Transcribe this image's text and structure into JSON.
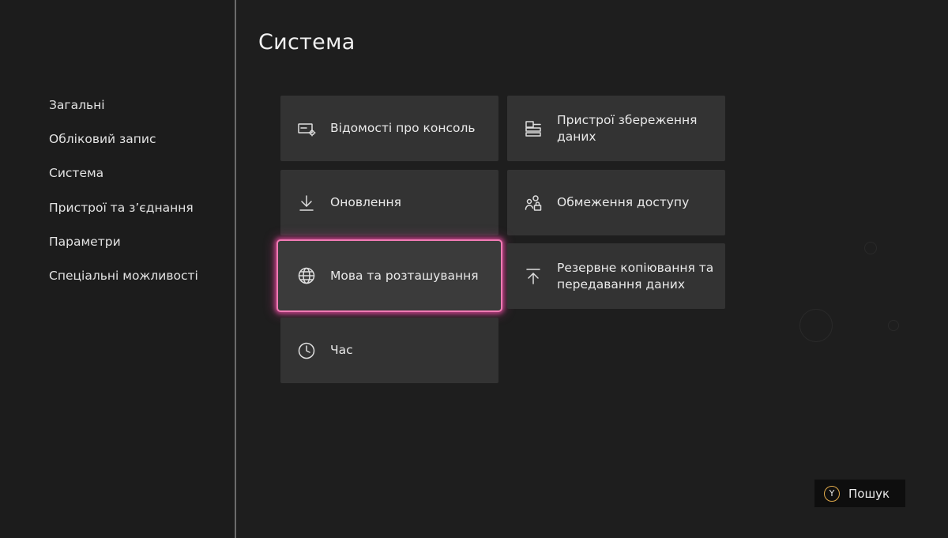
{
  "sidebar": {
    "items": [
      {
        "label": "Загальні"
      },
      {
        "label": "Обліковий запис"
      },
      {
        "label": "Система"
      },
      {
        "label": "Пристрої та з’єднання"
      },
      {
        "label": "Параметри"
      },
      {
        "label": "Спеціальні можливості"
      }
    ]
  },
  "page": {
    "title": "Система"
  },
  "tiles": [
    {
      "label": "Відомості про консоль",
      "icon": "console-info-icon"
    },
    {
      "label": "Пристрої збереження даних",
      "icon": "storage-icon"
    },
    {
      "label": "Оновлення",
      "icon": "download-icon"
    },
    {
      "label": "Обмеження доступу",
      "icon": "users-lock-icon"
    },
    {
      "label": "Мова та розташування",
      "icon": "globe-icon",
      "focused": true
    },
    {
      "label": "Резервне копіювання та передавання даних",
      "icon": "upload-icon"
    },
    {
      "label": "Час",
      "icon": "clock-icon"
    }
  ],
  "search": {
    "button_glyph": "Y",
    "label": "Пошук"
  },
  "colors": {
    "focus": "#e94aa0",
    "tile": "#333333",
    "background": "#1e1e1e",
    "y_button": "#e0a94a"
  }
}
